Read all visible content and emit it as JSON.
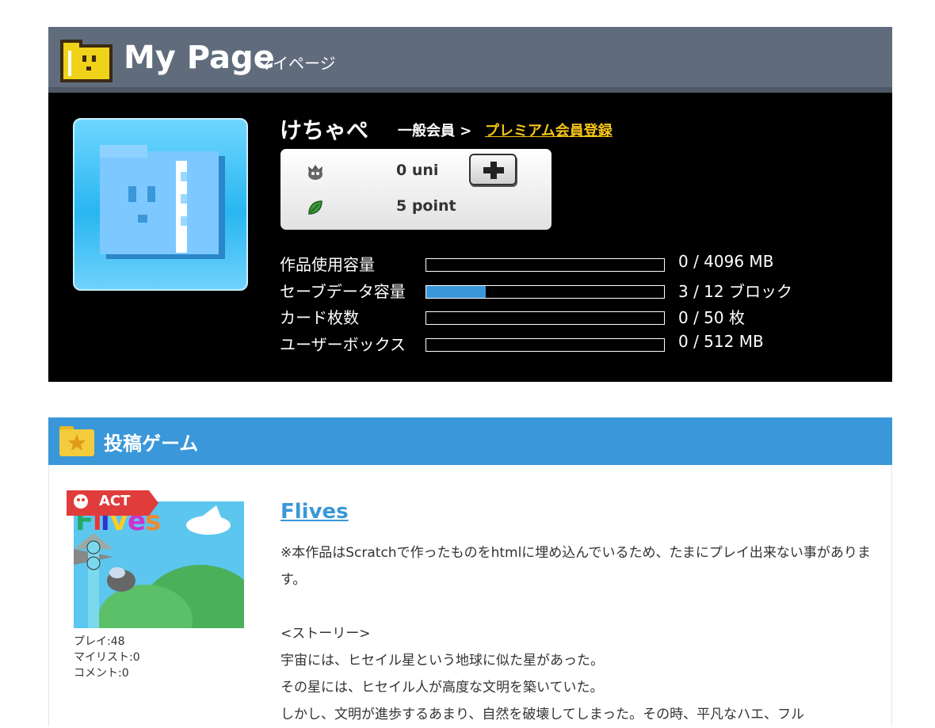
{
  "header": {
    "title": "My Page",
    "subtitle": "マイページ"
  },
  "profile": {
    "username": "けちゃぺ",
    "member_class": "一般会員 >",
    "premium_link": "プレミアム会員登録",
    "wallet": {
      "uni": "0  uni",
      "point": "5  point"
    },
    "capacities": [
      {
        "label": "作品使用容量",
        "value": "0 / 4096 MB",
        "fraction": 0.0
      },
      {
        "label": "セーブデータ容量",
        "value": "3 / 12 ブロック",
        "fraction": 0.25
      },
      {
        "label": "カード枚数",
        "value": "0 / 50 枚",
        "fraction": 0.0
      },
      {
        "label": "ユーザーボックス",
        "value": "0 / 512 MB",
        "fraction": 0.0
      }
    ]
  },
  "games": {
    "section_title": "投稿ゲーム",
    "items": [
      {
        "genre": "ACT",
        "title": "Flives",
        "plays": "プレイ:48",
        "mylist": "マイリスト:0",
        "comments": "コメント:0",
        "description": "※本作品はScratchで作ったものをhtmlに埋め込んでいるため、たまにプレイ出来ない事があります。\n\n<ストーリー>\n宇宙には、ヒセイル星という地球に似た星があった。\nその星には、ヒセイル人が高度な文明を築いていた。\nしかし、文明が進歩するあまり、自然を破壊してしまった。その時、平凡なハエ、フル"
      }
    ]
  },
  "colors": {
    "header_bg": "#606c7c",
    "accent_blue": "#3a97d9",
    "premium_yellow": "#f5c518",
    "profile_bg": "#000000"
  }
}
